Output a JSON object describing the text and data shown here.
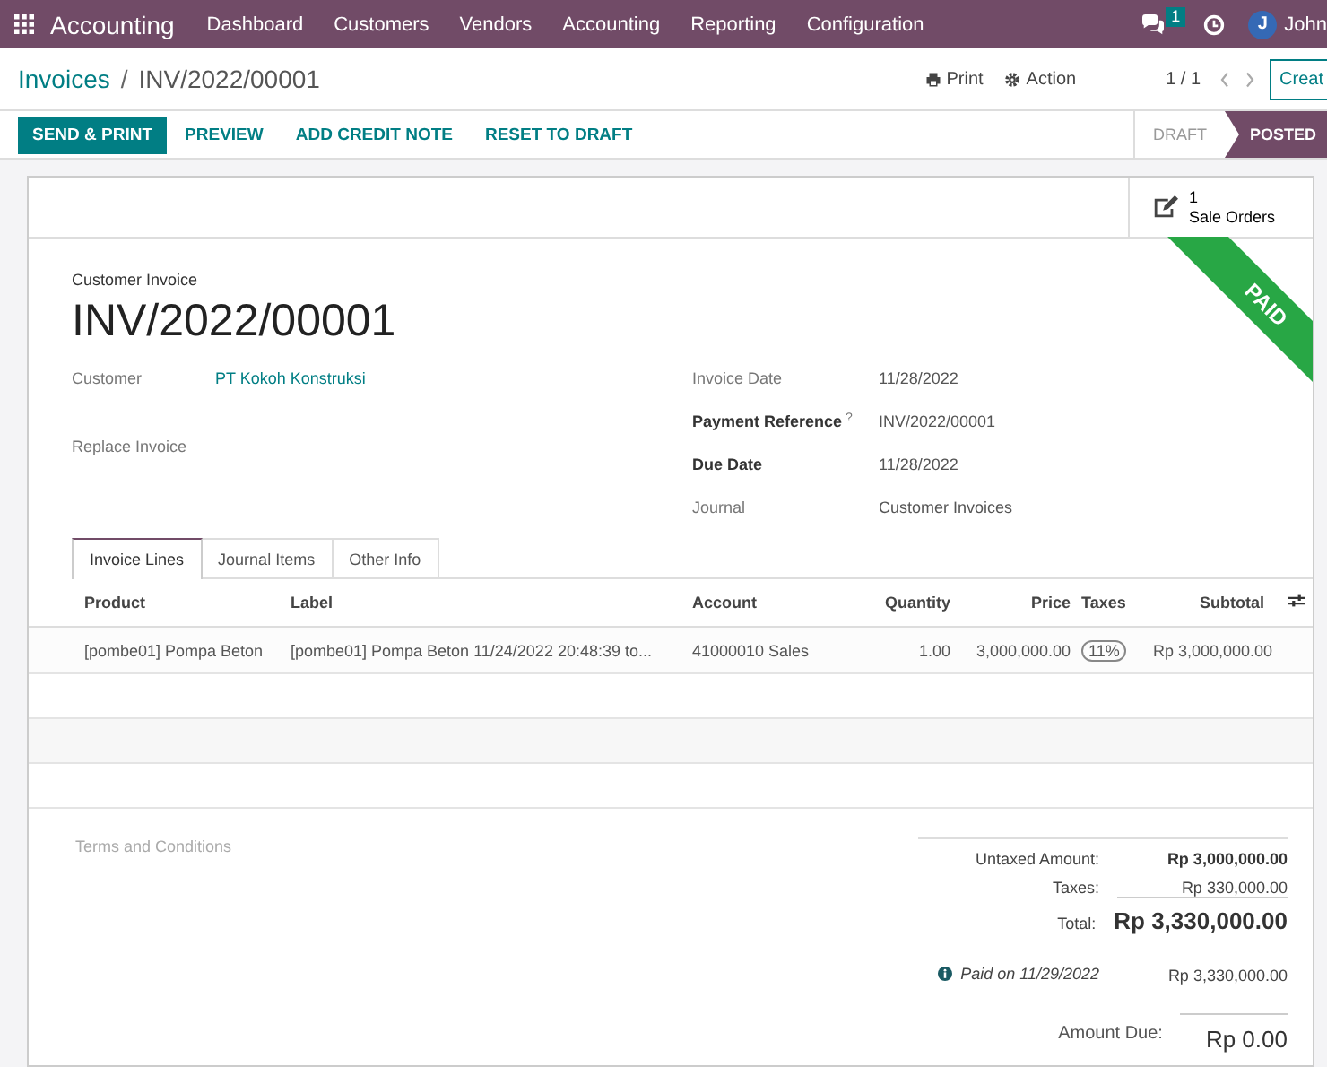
{
  "navbar": {
    "app": "Accounting",
    "menu": [
      "Dashboard",
      "Customers",
      "Vendors",
      "Accounting",
      "Reporting",
      "Configuration"
    ],
    "chat_badge": "1",
    "user_initial": "J",
    "user": "John"
  },
  "breadcrumb": {
    "parent": "Invoices",
    "separator": "/",
    "current": "INV/2022/00001"
  },
  "control_panel": {
    "print": "Print",
    "action": "Action",
    "pager": "1 / 1",
    "create": "Creat"
  },
  "buttons": [
    {
      "label": "SEND & PRINT",
      "primary": true
    },
    {
      "label": "PREVIEW",
      "primary": false
    },
    {
      "label": "ADD CREDIT NOTE",
      "primary": false
    },
    {
      "label": "RESET TO DRAFT",
      "primary": false
    }
  ],
  "statusbar": [
    {
      "label": "DRAFT",
      "selected": false
    },
    {
      "label": "POSTED",
      "selected": true
    }
  ],
  "smart_button": {
    "count": "1",
    "label": "Sale Orders"
  },
  "ribbon": "PAID",
  "form": {
    "type": "Customer Invoice",
    "number": "INV/2022/00001",
    "left": [
      {
        "label": "Customer",
        "value": "PT Kokoh Konstruksi",
        "required": false,
        "link": true
      },
      {
        "label": "Replace Invoice",
        "required": false
      }
    ],
    "right": [
      {
        "label": "Invoice Date",
        "value": "11/28/2022",
        "required": false
      },
      {
        "label": "Payment Reference",
        "help": "?",
        "value": "INV/2022/00001",
        "required": true
      },
      {
        "label": "Due Date",
        "value": "11/28/2022",
        "required": true
      },
      {
        "label": "Journal",
        "value": "Customer Invoices",
        "required": false
      }
    ]
  },
  "tabs": [
    {
      "label": "Invoice Lines",
      "selected": true
    },
    {
      "label": "Journal Items",
      "selected": false
    },
    {
      "label": "Other Info",
      "selected": false
    }
  ],
  "table": {
    "columns": [
      {
        "label": "Product",
        "kind": "text"
      },
      {
        "label": "Label",
        "kind": "text"
      },
      {
        "label": "Account",
        "kind": "text"
      },
      {
        "label": "Quantity",
        "kind": "number"
      },
      {
        "label": "Price",
        "kind": "number"
      },
      {
        "label": "Taxes",
        "kind": "tag"
      },
      {
        "label": "Subtotal",
        "kind": "number"
      }
    ],
    "rows": [
      [
        "[pombe01] Pompa Beton",
        "[pombe01] Pompa Beton 11/24/2022 20:48:39 to...",
        "41000010 Sales",
        "1.00",
        "3,000,000.00",
        "11%",
        "Rp 3,000,000.00"
      ]
    ]
  },
  "terms_placeholder": "Terms and Conditions",
  "totals": [
    {
      "kind": "untaxed",
      "label": "Untaxed Amount:",
      "value": "Rp 3,000,000.00"
    },
    {
      "kind": "plain",
      "label": "Taxes:",
      "value": "Rp 330,000.00"
    },
    {
      "kind": "total",
      "label": "Total:",
      "value": "Rp 3,330,000.00"
    },
    {
      "kind": "payment",
      "label": "Paid on 11/29/2022",
      "value": "Rp 3,330,000.00"
    },
    {
      "kind": "due",
      "label": "Amount Due:",
      "value": "Rp 0.00"
    }
  ]
}
